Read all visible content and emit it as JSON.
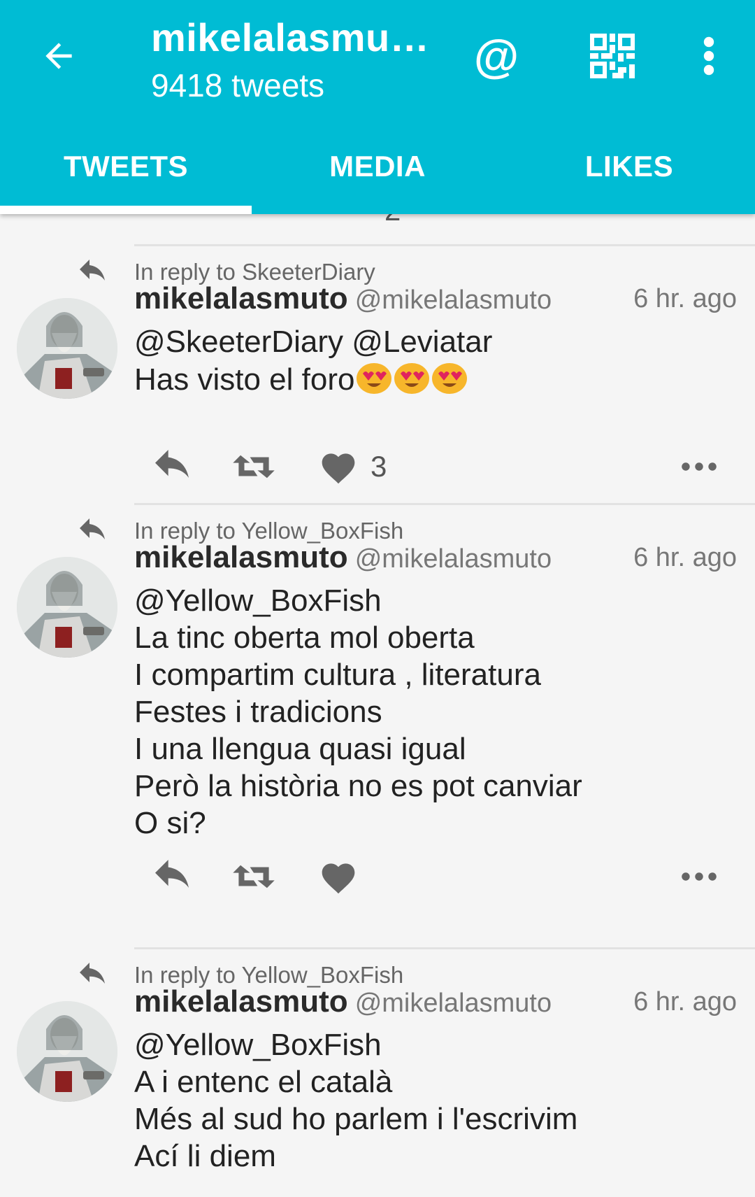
{
  "header": {
    "title": "mikelalasmu…",
    "subtitle": "9418 tweets",
    "at_symbol": "@",
    "icons": {
      "back": "arrow-back-icon",
      "mention": "at-icon",
      "qr": "qr-code-icon",
      "more": "more-vert-icon"
    }
  },
  "tabs": [
    {
      "label": "TWEETS",
      "active": true
    },
    {
      "label": "MEDIA",
      "active": false
    },
    {
      "label": "LIKES",
      "active": false
    }
  ],
  "partial_top": {
    "like_count": "2"
  },
  "tweets": [
    {
      "reply_to": "In reply to SkeeterDiary",
      "name": "mikelalasmuto",
      "handle": "@mikelalasmuto",
      "time": "6 hr. ago",
      "text": "@SkeeterDiary @Leviatar\nHas visto el foro",
      "emojis": [
        "heart-eyes-emoji",
        "heart-eyes-emoji",
        "heart-eyes-emoji"
      ],
      "like_count": "3"
    },
    {
      "reply_to": "In reply to Yellow_BoxFish",
      "name": "mikelalasmuto",
      "handle": "@mikelalasmuto",
      "time": "6 hr. ago",
      "text": "@Yellow_BoxFish\nLa tinc oberta mol oberta\nI compartim cultura , literatura\nFestes i tradicions\nI una llengua quasi igual\nPerò la història no es pot canviar\nO si?",
      "like_count": ""
    },
    {
      "reply_to": "In reply to Yellow_BoxFish",
      "name": "mikelalasmuto",
      "handle": "@mikelalasmuto",
      "time": "6 hr. ago",
      "text": "@Yellow_BoxFish\nA i entenc el català\nMés al sud ho parlem i l'escrivim\nAcí li diem",
      "like_count": ""
    }
  ],
  "colors": {
    "accent": "#00bcd4",
    "icon_gray": "#666666",
    "divider": "#e2e2e2"
  }
}
